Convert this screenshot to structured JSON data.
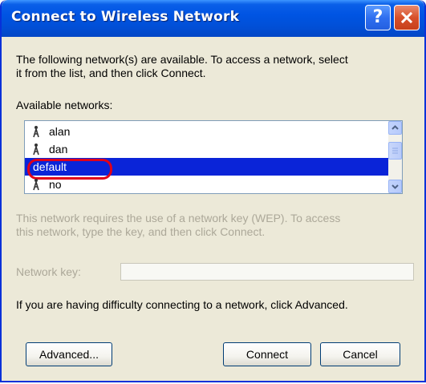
{
  "window": {
    "title": "Connect to Wireless Network",
    "help_glyph": "?"
  },
  "intro_line1": "The following network(s) are available. To access a network, select",
  "intro_line2": "it from the list, and then click Connect.",
  "available_label": "Available networks:",
  "networks": [
    {
      "name": "alan",
      "selected": false
    },
    {
      "name": "dan",
      "selected": false
    },
    {
      "name": "default",
      "selected": true
    },
    {
      "name": "no",
      "selected": false
    }
  ],
  "wep_line1": "This network requires the use of a network key (WEP). To access",
  "wep_line2": "this network, type the key, and then click Connect.",
  "network_key_label": "Network key:",
  "network_key_value": "",
  "difficulty_text": "If you are having difficulty connecting to a network, click Advanced.",
  "buttons": {
    "advanced": "Advanced...",
    "connect": "Connect",
    "cancel": "Cancel"
  },
  "colors": {
    "titlebar": "#0054e3",
    "selection": "#0a24d8",
    "highlight_ring": "#e0001a",
    "disabled_text": "#aca899"
  },
  "icons": {
    "network_item": "wireless-antenna-icon",
    "help": "help-icon",
    "close": "close-icon"
  }
}
